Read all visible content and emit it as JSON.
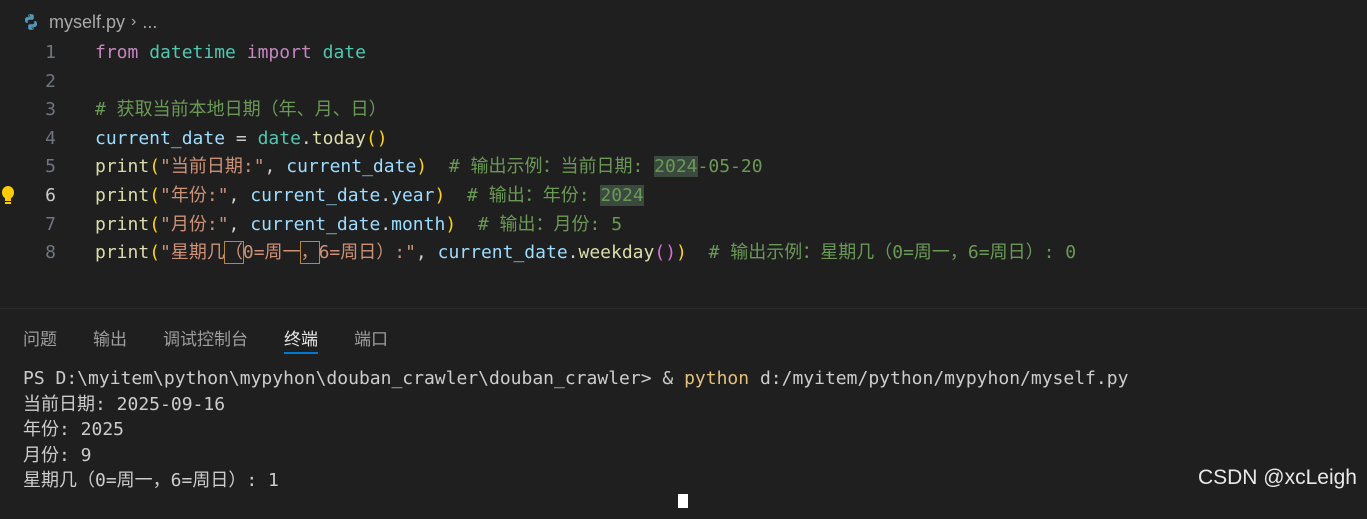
{
  "breadcrumb": {
    "file": "myself.py",
    "more": "..."
  },
  "editor": {
    "active_line": 6,
    "lines": [
      {
        "n": "1",
        "tokens": [
          {
            "c": "kw",
            "t": "from"
          },
          {
            "c": "",
            "t": " "
          },
          {
            "c": "mod",
            "t": "datetime"
          },
          {
            "c": "",
            "t": " "
          },
          {
            "c": "kw",
            "t": "import"
          },
          {
            "c": "",
            "t": " "
          },
          {
            "c": "mod",
            "t": "date"
          }
        ]
      },
      {
        "n": "2",
        "tokens": []
      },
      {
        "n": "3",
        "tokens": [
          {
            "c": "cm",
            "t": "# 获取当前本地日期（年、月、日）"
          }
        ]
      },
      {
        "n": "4",
        "tokens": [
          {
            "c": "var",
            "t": "current_date"
          },
          {
            "c": "",
            "t": " = "
          },
          {
            "c": "mod",
            "t": "date"
          },
          {
            "c": "",
            "t": "."
          },
          {
            "c": "fn",
            "t": "today"
          },
          {
            "c": "p1",
            "t": "()"
          }
        ]
      },
      {
        "n": "5",
        "tokens": [
          {
            "c": "fn",
            "t": "print"
          },
          {
            "c": "p1",
            "t": "("
          },
          {
            "c": "str",
            "t": "\"当前日期:\""
          },
          {
            "c": "",
            "t": ", "
          },
          {
            "c": "var",
            "t": "current_date"
          },
          {
            "c": "p1",
            "t": ")"
          },
          {
            "c": "",
            "t": "  "
          },
          {
            "c": "cm",
            "t": "# 输出示例：当前日期: "
          },
          {
            "c": "cm hl",
            "t": "2024"
          },
          {
            "c": "cm",
            "t": "-05-20"
          }
        ]
      },
      {
        "n": "6",
        "tokens": [
          {
            "c": "fn",
            "t": "print"
          },
          {
            "c": "p1",
            "t": "("
          },
          {
            "c": "str",
            "t": "\"年份:\""
          },
          {
            "c": "",
            "t": ", "
          },
          {
            "c": "var",
            "t": "current_date"
          },
          {
            "c": "",
            "t": "."
          },
          {
            "c": "var",
            "t": "year"
          },
          {
            "c": "p1",
            "t": ")"
          },
          {
            "c": "",
            "t": "  "
          },
          {
            "c": "cm",
            "t": "# 输出：年份: "
          },
          {
            "c": "cm hl",
            "t": "2024"
          }
        ]
      },
      {
        "n": "7",
        "tokens": [
          {
            "c": "fn",
            "t": "print"
          },
          {
            "c": "p1",
            "t": "("
          },
          {
            "c": "str",
            "t": "\"月份:\""
          },
          {
            "c": "",
            "t": ", "
          },
          {
            "c": "var",
            "t": "current_date"
          },
          {
            "c": "",
            "t": "."
          },
          {
            "c": "var",
            "t": "month"
          },
          {
            "c": "p1",
            "t": ")"
          },
          {
            "c": "",
            "t": "  "
          },
          {
            "c": "cm",
            "t": "# 输出：月份: 5"
          }
        ]
      },
      {
        "n": "8",
        "tokens": [
          {
            "c": "fn",
            "t": "print"
          },
          {
            "c": "p1",
            "t": "("
          },
          {
            "c": "str",
            "t": "\"星期几"
          },
          {
            "c": "str box",
            "t": "（"
          },
          {
            "c": "str",
            "t": "0=周一"
          },
          {
            "c": "str box",
            "t": "，"
          },
          {
            "c": "str",
            "t": "6=周日）:\""
          },
          {
            "c": "",
            "t": ", "
          },
          {
            "c": "var",
            "t": "current_date"
          },
          {
            "c": "",
            "t": "."
          },
          {
            "c": "fn",
            "t": "weekday"
          },
          {
            "c": "p2",
            "t": "()"
          },
          {
            "c": "p1",
            "t": ")"
          },
          {
            "c": "",
            "t": "  "
          },
          {
            "c": "cm",
            "t": "# 输出示例：星期几（0=周一，6=周日）: 0"
          }
        ]
      }
    ]
  },
  "panel": {
    "tabs": [
      {
        "label": "问题",
        "active": false
      },
      {
        "label": "输出",
        "active": false
      },
      {
        "label": "调试控制台",
        "active": false
      },
      {
        "label": "终端",
        "active": true
      },
      {
        "label": "端口",
        "active": false
      }
    ]
  },
  "terminal": {
    "prompt": "PS D:\\myitem\\python\\mypyhon\\douban_crawler\\douban_crawler> ",
    "amp": "& ",
    "python": "python",
    "script": " d:/myitem/python/mypyhon/myself.py",
    "output": [
      "当前日期: 2025-09-16",
      "年份: 2025",
      "月份: 9",
      "星期几（0=周一，6=周日）: 1"
    ]
  },
  "watermark": "CSDN @xcLeigh",
  "colors": {
    "background": "#1f1f1f",
    "accent": "#0078d4",
    "keyword": "#c586c0",
    "string": "#ce9178",
    "comment": "#6a9955"
  },
  "icons": {
    "file": "python-icon",
    "hint": "lightbulb-icon",
    "chevron": "chevron-right-icon"
  }
}
